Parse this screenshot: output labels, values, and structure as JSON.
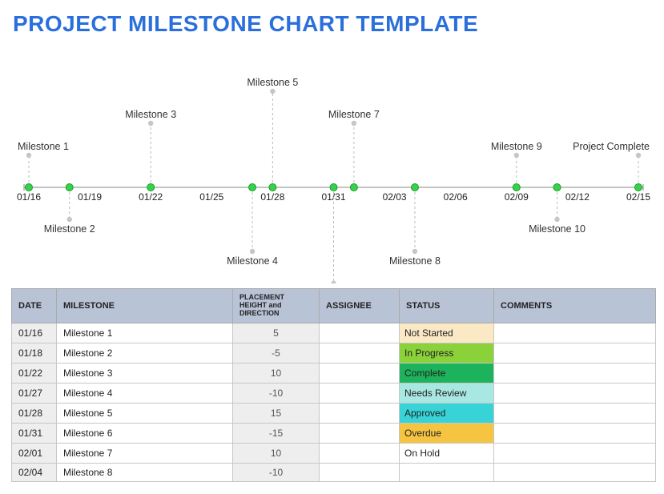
{
  "title": "PROJECT MILESTONE CHART TEMPLATE",
  "chart": {
    "ticks": [
      "01/16",
      "01/19",
      "01/22",
      "01/25",
      "01/28",
      "01/31",
      "02/03",
      "02/06",
      "02/09",
      "02/12",
      "02/15"
    ],
    "x_min_day": 16,
    "x_max_day": 46,
    "milestones": [
      {
        "name": "Milestone 1",
        "date_day": 16,
        "h": 5
      },
      {
        "name": "Milestone 2",
        "date_day": 18,
        "h": -5
      },
      {
        "name": "Milestone 3",
        "date_day": 22,
        "h": 10
      },
      {
        "name": "Milestone 4",
        "date_day": 27,
        "h": -10
      },
      {
        "name": "Milestone 5",
        "date_day": 28,
        "h": 15
      },
      {
        "name": "Milestone 6",
        "date_day": 31,
        "h": -15
      },
      {
        "name": "Milestone 7",
        "date_day": 32,
        "h": 10
      },
      {
        "name": "Milestone 8",
        "date_day": 35,
        "h": -10
      },
      {
        "name": "Milestone 9",
        "date_day": 40,
        "h": 5
      },
      {
        "name": "Milestone 10",
        "date_day": 42,
        "h": -5
      },
      {
        "name": "Project Complete",
        "date_day": 46,
        "h": 5
      }
    ]
  },
  "table": {
    "headers": [
      "DATE",
      "MILESTONE",
      "PLACEMENT HEIGHT and DIRECTION",
      "ASSIGNEE",
      "STATUS",
      "COMMENTS"
    ],
    "rows": [
      {
        "date": "01/16",
        "milestone": "Milestone 1",
        "placement": "5",
        "assignee": "",
        "status": "Not Started",
        "status_color": "#fbe9c6",
        "comments": ""
      },
      {
        "date": "01/18",
        "milestone": "Milestone 2",
        "placement": "-5",
        "assignee": "",
        "status": "In Progress",
        "status_color": "#8bd13a",
        "comments": ""
      },
      {
        "date": "01/22",
        "milestone": "Milestone 3",
        "placement": "10",
        "assignee": "",
        "status": "Complete",
        "status_color": "#1db35c",
        "comments": ""
      },
      {
        "date": "01/27",
        "milestone": "Milestone 4",
        "placement": "-10",
        "assignee": "",
        "status": "Needs Review",
        "status_color": "#a9e7e2",
        "comments": ""
      },
      {
        "date": "01/28",
        "milestone": "Milestone 5",
        "placement": "15",
        "assignee": "",
        "status": "Approved",
        "status_color": "#38d3d6",
        "comments": ""
      },
      {
        "date": "01/31",
        "milestone": "Milestone 6",
        "placement": "-15",
        "assignee": "",
        "status": "Overdue",
        "status_color": "#f5c542",
        "comments": ""
      },
      {
        "date": "02/01",
        "milestone": "Milestone 7",
        "placement": "10",
        "assignee": "",
        "status": "On Hold",
        "status_color": "#ffffff",
        "comments": ""
      },
      {
        "date": "02/04",
        "milestone": "Milestone 8",
        "placement": "-10",
        "assignee": "",
        "status": "",
        "status_color": "",
        "comments": ""
      }
    ]
  },
  "chart_data": {
    "type": "timeline",
    "title": "PROJECT MILESTONE CHART TEMPLATE",
    "x_ticks": [
      "01/16",
      "01/19",
      "01/22",
      "01/25",
      "01/28",
      "01/31",
      "02/03",
      "02/06",
      "02/09",
      "02/12",
      "02/15"
    ],
    "series": [
      {
        "name": "Milestones",
        "points": [
          {
            "x": "01/16",
            "y": 5,
            "label": "Milestone 1"
          },
          {
            "x": "01/18",
            "y": -5,
            "label": "Milestone 2"
          },
          {
            "x": "01/22",
            "y": 10,
            "label": "Milestone 3"
          },
          {
            "x": "01/27",
            "y": -10,
            "label": "Milestone 4"
          },
          {
            "x": "01/28",
            "y": 15,
            "label": "Milestone 5"
          },
          {
            "x": "01/31",
            "y": -15,
            "label": "Milestone 6"
          },
          {
            "x": "02/01",
            "y": 10,
            "label": "Milestone 7"
          },
          {
            "x": "02/04",
            "y": -10,
            "label": "Milestone 8"
          },
          {
            "x": "02/09",
            "y": 5,
            "label": "Milestone 9"
          },
          {
            "x": "02/11",
            "y": -5,
            "label": "Milestone 10"
          },
          {
            "x": "02/15",
            "y": 5,
            "label": "Project Complete"
          }
        ]
      }
    ],
    "xlabel": "",
    "ylabel": "",
    "ylim": [
      -15,
      15
    ]
  }
}
